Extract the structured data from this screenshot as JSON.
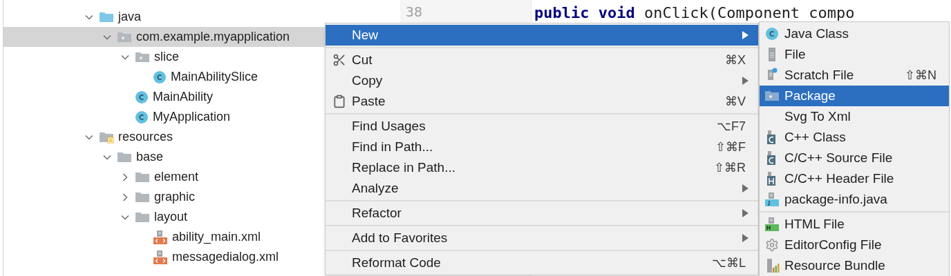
{
  "tree": [
    {
      "label": "java",
      "kind": "source-folder",
      "expanded": true,
      "selected": false,
      "children": [
        {
          "label": "com.example.myapplication",
          "kind": "package",
          "expanded": true,
          "selected": true,
          "children": [
            {
              "label": "slice",
              "kind": "package",
              "expanded": true,
              "selected": false,
              "children": [
                {
                  "label": "MainAbilitySlice",
                  "kind": "class",
                  "selected": false
                }
              ]
            },
            {
              "label": "MainAbility",
              "kind": "class",
              "selected": false
            },
            {
              "label": "MyApplication",
              "kind": "class",
              "selected": false
            }
          ]
        }
      ]
    },
    {
      "label": "resources",
      "kind": "resources",
      "expanded": true,
      "selected": false,
      "children": [
        {
          "label": "base",
          "kind": "folder",
          "expanded": true,
          "selected": false,
          "children": [
            {
              "label": "element",
              "kind": "folder",
              "expanded": false,
              "selected": false
            },
            {
              "label": "graphic",
              "kind": "folder",
              "expanded": false,
              "selected": false
            },
            {
              "label": "layout",
              "kind": "folder",
              "expanded": true,
              "selected": false,
              "children": [
                {
                  "label": "ability_main.xml",
                  "kind": "xml",
                  "selected": false
                },
                {
                  "label": "messagedialog.xml",
                  "kind": "xml",
                  "selected": false
                }
              ]
            }
          ]
        }
      ]
    }
  ],
  "editor": {
    "line_number": "38",
    "code": "**public void** onClick(Component compo"
  },
  "context_menu": {
    "groups": [
      [
        {
          "label": "New",
          "submenu": true,
          "selected": true
        }
      ],
      [
        {
          "label": "Cut",
          "kind": "cut",
          "shortcut": "⌘X",
          "selected": false
        },
        {
          "label": "Copy",
          "submenu": true,
          "selected": false
        },
        {
          "label": "Paste",
          "kind": "paste",
          "shortcut": "⌘V",
          "selected": false
        }
      ],
      [
        {
          "label": "Find Usages",
          "shortcut": "⌥F7",
          "selected": false
        },
        {
          "label": "Find in Path...",
          "shortcut": "⇧⌘F",
          "selected": false
        },
        {
          "label": "Replace in Path...",
          "shortcut": "⇧⌘R",
          "selected": false
        },
        {
          "label": "Analyze",
          "submenu": true,
          "selected": false
        }
      ],
      [
        {
          "label": "Refactor",
          "submenu": true,
          "selected": false
        }
      ],
      [
        {
          "label": "Add to Favorites",
          "submenu": true,
          "selected": false
        }
      ],
      [
        {
          "label": "Reformat Code",
          "shortcut": "⌥⌘L",
          "selected": false
        }
      ]
    ]
  },
  "new_submenu": {
    "groups": [
      [
        {
          "label": "Java Class",
          "kind": "class",
          "selected": false
        },
        {
          "label": "File",
          "kind": "file",
          "selected": false
        },
        {
          "label": "Scratch File",
          "kind": "scratch",
          "shortcut": "⇧⌘N",
          "selected": false
        },
        {
          "label": "Package",
          "kind": "package",
          "selected": true
        },
        {
          "label": "Svg To Xml",
          "selected": false
        },
        {
          "label": "C++ Class",
          "kind": "cpp-class",
          "selected": false
        },
        {
          "label": "C/C++ Source File",
          "kind": "c-source",
          "selected": false
        },
        {
          "label": "C/C++ Header File",
          "kind": "c-header",
          "selected": false
        },
        {
          "label": "package-info.java",
          "kind": "java-file",
          "selected": false
        }
      ],
      [
        {
          "label": "HTML File",
          "kind": "html",
          "selected": false
        },
        {
          "label": "EditorConfig File",
          "kind": "gear",
          "selected": false
        },
        {
          "label": "Resource Bundle",
          "kind": "bundle",
          "selected": false
        }
      ]
    ]
  }
}
